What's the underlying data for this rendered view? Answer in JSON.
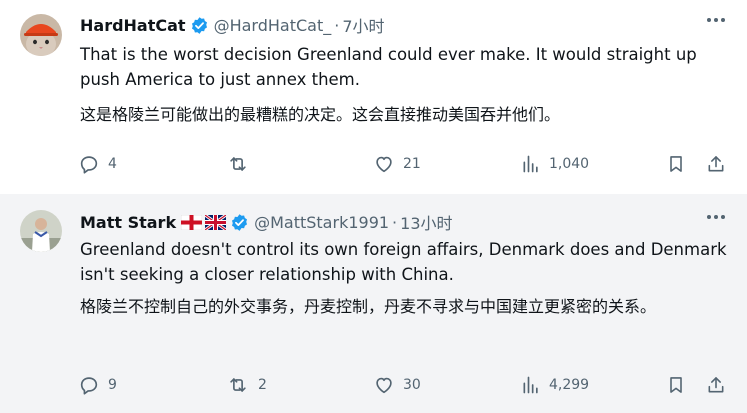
{
  "tweets": [
    {
      "author": "HardHatCat",
      "handle": "@HardHatCat_",
      "separator": "·",
      "time": "7小时",
      "text_en": "That is the worst decision Greenland could ever make. It would straight up push America to just annex them.",
      "text_zh": "这是格陵兰可能做出的最糟糕的决定。这会直接推动美国吞并他们。",
      "replies": "4",
      "reposts": "",
      "likes": "21",
      "views": "1,040"
    },
    {
      "author": "Matt Stark",
      "flags": [
        "england-flag-icon",
        "uk-flag-icon"
      ],
      "handle": "@MattStark1991",
      "separator": "·",
      "time": "13小时",
      "text_en": "Greenland doesn't control its own foreign affairs, Denmark does and Denmark isn't seeking a closer relationship with China.",
      "text_zh": "格陵兰不控制自己的外交事务，丹麦控制，丹麦不寻求与中国建立更紧密的关系。",
      "replies": "9",
      "reposts": "2",
      "likes": "30",
      "views": "4,299"
    }
  ],
  "colors": {
    "verified": "#1d9bf0",
    "secondary_text": "#536471",
    "primary_text": "#0f1419"
  }
}
